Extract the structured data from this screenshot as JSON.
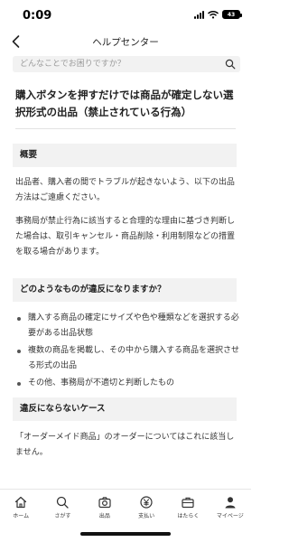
{
  "status": {
    "time": "0:09",
    "battery": "43"
  },
  "header": {
    "title": "ヘルプセンター"
  },
  "search": {
    "placeholder": "どんなことでお困りですか？"
  },
  "article": {
    "title": "購入ボタンを押すだけでは商品が確定しない選択形式の出品（禁止されている行為）",
    "sections": [
      {
        "heading": "概要",
        "paragraphs": [
          "出品者、購入者の間でトラブルが起きないよう、以下の出品方法はご遠慮ください。",
          "事務局が禁止行為に該当すると合理的な理由に基づき判断した場合は、取引キャンセル・商品削除・利用制限などの措置を取る場合があります。"
        ]
      },
      {
        "heading": "どのようなものが違反になりますか？",
        "bullets": [
          "購入する商品の確定にサイズや色や種類などを選択する必要がある出品状態",
          "複数の商品を掲載し、その中から購入する商品を選択させる形式の出品",
          "その他、事務局が不適切と判断したもの"
        ]
      },
      {
        "heading": "違反にならないケース",
        "paragraphs": [
          "「オーダーメイド商品」のオーダーについてはこれに該当しません。"
        ]
      }
    ]
  },
  "tabbar": {
    "items": [
      {
        "label": "ホーム",
        "icon": "home-icon"
      },
      {
        "label": "さがす",
        "icon": "search-icon"
      },
      {
        "label": "出品",
        "icon": "camera-icon"
      },
      {
        "label": "支払い",
        "icon": "yen-coin-icon"
      },
      {
        "label": "はたらく",
        "icon": "briefcase-icon"
      },
      {
        "label": "マイページ",
        "icon": "person-icon"
      }
    ]
  }
}
